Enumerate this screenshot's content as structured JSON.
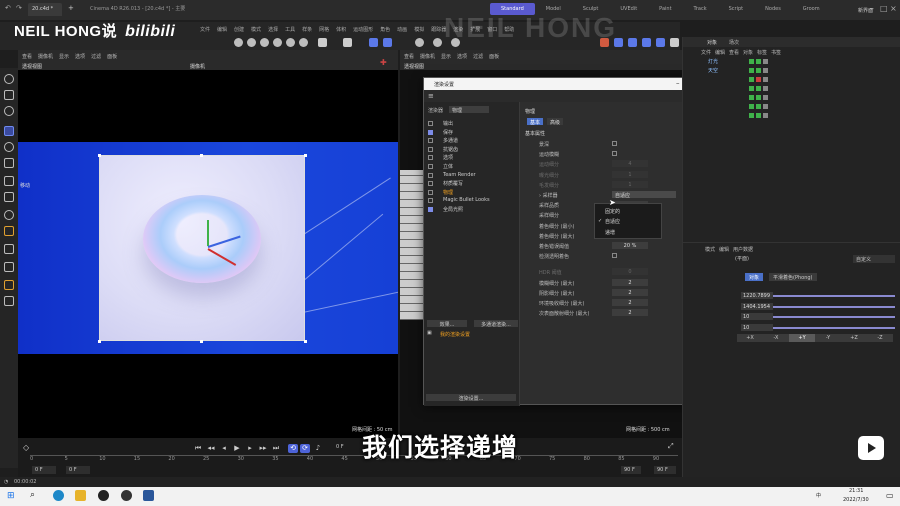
{
  "titlebar": {
    "tab": "20.c4d *",
    "window_title": "Cinema 4D R26.013 - [20.c4d *] - 主要",
    "layouts": [
      "Standard",
      "Model",
      "Sculpt",
      "UVEdit",
      "Paint",
      "Track",
      "Script",
      "Nodes",
      "Groom"
    ],
    "new_layout": "新界面"
  },
  "brand": {
    "name": "NEIL HONG说",
    "site": "bilibili",
    "watermark": "NEIL HONG"
  },
  "menubar": {
    "items": [
      "文件",
      "编辑",
      "创建",
      "模式",
      "选择",
      "工具",
      "样条",
      "网格",
      "体积",
      "运动图形",
      "角色",
      "动画",
      "模拟",
      "跟踪器",
      "渲染",
      "扩展",
      "窗口",
      "帮助"
    ]
  },
  "viewport": {
    "menu": [
      "查看",
      "摄像机",
      "显示",
      "选项",
      "过滤",
      "面板"
    ],
    "caption": "透视视图",
    "camera": "摄像机",
    "move_label": "移动",
    "grid_spacing": "网格间距 : 50 cm"
  },
  "viewport2": {
    "menu": [
      "查看",
      "摄像机",
      "显示",
      "选项",
      "过滤",
      "面板"
    ],
    "caption": "透视视图",
    "grid_spacing": "网格间距 : 500 cm"
  },
  "dialog": {
    "title": "渲染设置",
    "renderer_label": "渲染器",
    "renderer_value": "物理",
    "effects": [
      {
        "name": "输出",
        "checked": false,
        "selected": false
      },
      {
        "name": "保存",
        "checked": true,
        "selected": false
      },
      {
        "name": "多通道",
        "checked": false,
        "selected": false
      },
      {
        "name": "抗锯齿",
        "checked": false,
        "selected": false
      },
      {
        "name": "选项",
        "checked": false,
        "selected": false
      },
      {
        "name": "立体",
        "checked": false,
        "selected": false
      },
      {
        "name": "Team Render",
        "checked": false,
        "selected": false
      },
      {
        "name": "材质覆写",
        "checked": false,
        "selected": false
      },
      {
        "name": "物理",
        "checked": false,
        "selected": true
      },
      {
        "name": "Magic Bullet Looks",
        "checked": false,
        "selected": false
      },
      {
        "name": "全局光照",
        "checked": true,
        "selected": false
      }
    ],
    "effect_button": "效果...",
    "multipass_button": "多通道渲染...",
    "my_settings": "我的渲染设置",
    "render_settings_button": "渲染设置...",
    "section": "物理",
    "tabs": [
      "基本",
      "高级"
    ],
    "group": "基本属性",
    "properties": [
      {
        "label": "景深",
        "type": "check",
        "dim": false
      },
      {
        "label": "运动模糊",
        "type": "check",
        "dim": false
      },
      {
        "label": "运动细分",
        "type": "value",
        "value": "4",
        "dim": true
      },
      {
        "label": "曝光细分",
        "type": "value",
        "value": "1",
        "dim": true
      },
      {
        "label": "毛发细分",
        "type": "value",
        "value": "1",
        "dim": true
      },
      {
        "label": "› 采样器",
        "type": "dropdown",
        "value": "自适应",
        "dim": false
      },
      {
        "label": "采样品质",
        "type": "value",
        "value": "",
        "dim": false
      },
      {
        "label": "采样细分",
        "type": "value",
        "value": "",
        "dim": false
      },
      {
        "label": "着色细分 (最小)",
        "type": "value",
        "value": "",
        "dim": false
      },
      {
        "label": "着色细分 (最大)",
        "type": "value",
        "value": "",
        "dim": false
      },
      {
        "label": "着色错误阈值",
        "type": "value",
        "value": "20 %",
        "dim": false
      },
      {
        "label": "检测透明着色",
        "type": "check",
        "dim": false
      },
      {
        "label": "HDR 阈值",
        "type": "value",
        "value": "0",
        "dim": true
      },
      {
        "label": "模糊细分 (最大)",
        "type": "value",
        "value": "2",
        "dim": false
      },
      {
        "label": "阴影细分 (最大)",
        "type": "value",
        "value": "2",
        "dim": false
      },
      {
        "label": "环境吸收细分 (最大)",
        "type": "value",
        "value": "2",
        "dim": false
      },
      {
        "label": "次表面散射细分 (最大)",
        "type": "value",
        "value": "2",
        "dim": false
      }
    ],
    "dropdown_options": [
      "固定的",
      "自适应",
      "递增"
    ],
    "dropdown_checked_index": 1
  },
  "object_manager": {
    "tabs": [
      "对象",
      "场次"
    ],
    "menu": [
      "文件",
      "编辑",
      "查看",
      "对象",
      "标签",
      "书签"
    ],
    "objects": [
      "灯光",
      "天空",
      "",
      "",
      "",
      "",
      ""
    ]
  },
  "attribute_manager": {
    "menu": [
      "模式",
      "编辑",
      "用户数据"
    ],
    "title": "(平面)",
    "tabs": [
      "对象",
      "平滑着色(Phong)"
    ],
    "preset": "自定义",
    "values": [
      "1220.7899",
      "1404.1954",
      "10",
      "10"
    ],
    "axes": [
      "+X",
      "-X",
      "+Y",
      "-Y",
      "+Z",
      "-Z"
    ],
    "active_axis": "+Y"
  },
  "timeline": {
    "ticks": [
      "0",
      "5",
      "10",
      "15",
      "20",
      "25",
      "30",
      "35",
      "40",
      "45",
      "50",
      "55",
      "60",
      "65",
      "70",
      "75",
      "80",
      "85",
      "90"
    ],
    "start": "0 F",
    "current": "0 F",
    "frame_display": "0 F",
    "end1": "90 F",
    "end2": "90 F"
  },
  "status": {
    "time": "00:00:02"
  },
  "subtitle": "我们选择递增",
  "taskbar": {
    "time": "21:31",
    "date": "2022/7/30",
    "ime": "中"
  }
}
